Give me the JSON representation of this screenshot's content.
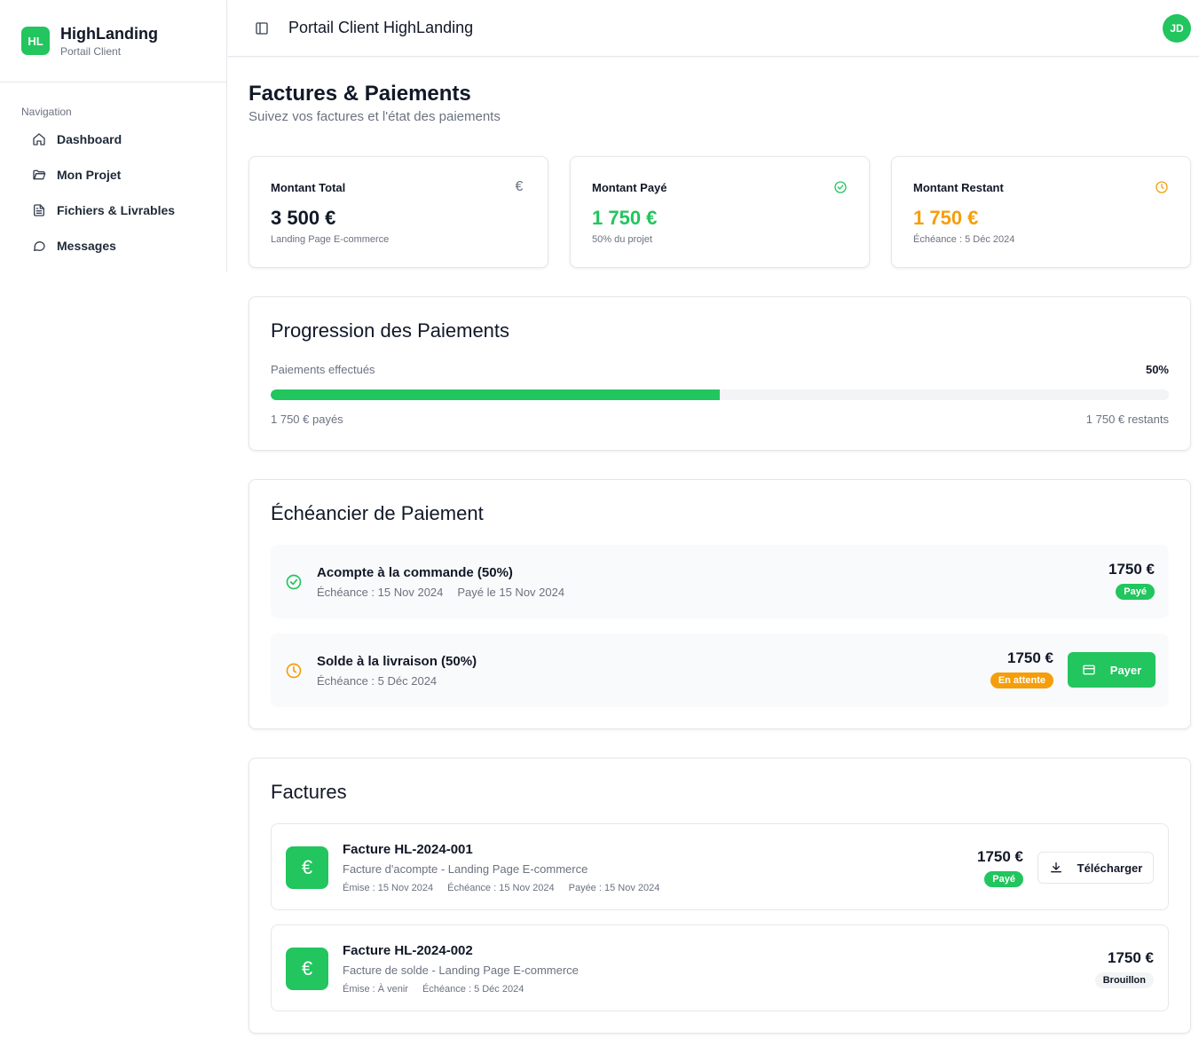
{
  "brand": {
    "logo_text": "HL",
    "name": "HighLanding",
    "subtitle": "Portail Client"
  },
  "sidebar": {
    "section_title": "Navigation",
    "items": [
      {
        "label": "Dashboard",
        "icon": "home-icon"
      },
      {
        "label": "Mon Projet",
        "icon": "folder-icon"
      },
      {
        "label": "Fichiers & Livrables",
        "icon": "file-icon"
      },
      {
        "label": "Messages",
        "icon": "message-icon"
      }
    ]
  },
  "header": {
    "title": "Portail Client HighLanding",
    "avatar_initials": "JD"
  },
  "page": {
    "title": "Factures & Paiements",
    "subtitle": "Suivez vos factures et l'état des paiements"
  },
  "stats": [
    {
      "label": "Montant Total",
      "value": "3 500 €",
      "note": "Landing Page E-commerce",
      "icon": "euro-icon",
      "color": "#111827"
    },
    {
      "label": "Montant Payé",
      "value": "1 750 €",
      "note": "50% du projet",
      "icon": "check-circle-icon",
      "color": "#22c55e"
    },
    {
      "label": "Montant Restant",
      "value": "1 750 €",
      "note": "Échéance : 5 Déc 2024",
      "icon": "clock-icon",
      "color": "#f59e0b"
    }
  ],
  "progress": {
    "title": "Progression des Paiements",
    "label": "Paiements effectués",
    "percent_text": "50%",
    "percent": 50,
    "paid_text": "1 750 € payés",
    "remaining_text": "1 750 € restants"
  },
  "schedule": {
    "title": "Échéancier de Paiement",
    "items": [
      {
        "title": "Acompte à la commande (50%)",
        "due": "Échéance : 15 Nov 2024",
        "paid_on": "Payé le 15 Nov 2024",
        "amount": "1750 €",
        "status": "Payé",
        "icon": "check-circle-icon"
      },
      {
        "title": "Solde à la livraison (50%)",
        "due": "Échéance : 5 Déc 2024",
        "amount": "1750 €",
        "status": "En attente",
        "icon": "clock-icon",
        "action": "Payer"
      }
    ]
  },
  "invoices": {
    "title": "Factures",
    "items": [
      {
        "number": "Facture HL-2024-001",
        "description": "Facture d'acompte - Landing Page E-commerce",
        "issued": "Émise : 15 Nov 2024",
        "due": "Échéance : 15 Nov 2024",
        "paid": "Payée : 15 Nov 2024",
        "amount": "1750 €",
        "status": "Payé",
        "action": "Télécharger",
        "icon_glyph": "€"
      },
      {
        "number": "Facture HL-2024-002",
        "description": "Facture de solde - Landing Page E-commerce",
        "issued": "Émise : À venir",
        "due": "Échéance : 5 Déc 2024",
        "amount": "1750 €",
        "status": "Brouillon",
        "icon_glyph": "€"
      }
    ]
  },
  "colors": {
    "accent": "#22c55e",
    "warning": "#f59e0b",
    "muted": "#6b7280",
    "border": "#e5e7eb"
  }
}
